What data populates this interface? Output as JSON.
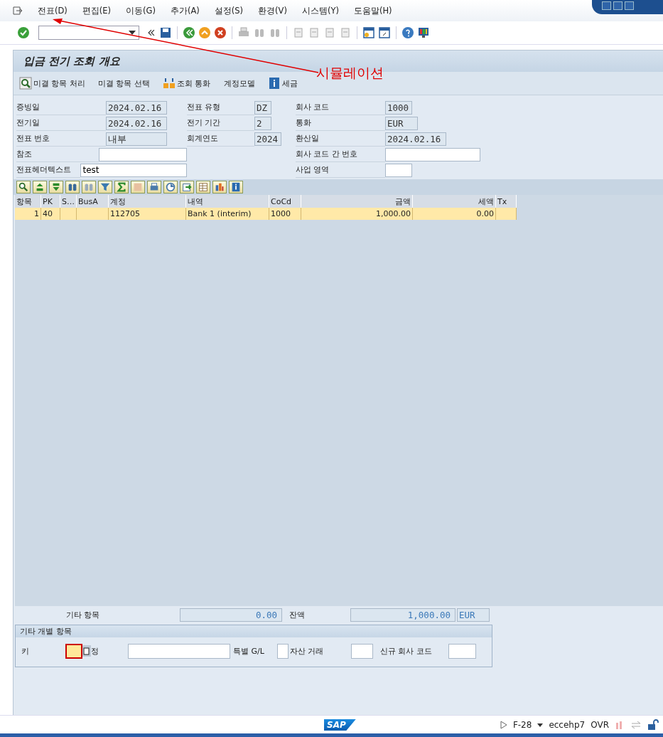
{
  "menu": [
    "전표(D)",
    "편집(E)",
    "이동(G)",
    "추가(A)",
    "설정(S)",
    "환경(V)",
    "시스템(Y)",
    "도움말(H)"
  ],
  "annotation": {
    "text": "시뮬레이션"
  },
  "screen": {
    "title": "입금 전기 조회 개요"
  },
  "app_toolbar": [
    {
      "kind": "icon-text",
      "label": "미결 항목 처리"
    },
    {
      "kind": "text",
      "label": "미결 항목 선택"
    },
    {
      "kind": "currency",
      "label": "조회 통화"
    },
    {
      "kind": "text",
      "label": "계정모델"
    },
    {
      "kind": "info",
      "label": "세금"
    }
  ],
  "header_form": [
    {
      "left": {
        "label": "증빙일",
        "value": "2024.02.16",
        "editable": false
      },
      "middle": {
        "label": "전표 유형",
        "value": "DZ",
        "editable": false
      },
      "right": {
        "label": "회사 코드",
        "value": "1000",
        "editable": false
      }
    },
    {
      "left": {
        "label": "전기일",
        "value": "2024.02.16",
        "editable": false
      },
      "middle": {
        "label": "전기 기간",
        "value": "2",
        "editable": false
      },
      "right": {
        "label": "통화",
        "value": "EUR",
        "editable": false
      }
    },
    {
      "left": {
        "label": "전표 번호",
        "value": "내부",
        "editable": false
      },
      "middle": {
        "label": "회계연도",
        "value": "2024",
        "editable": false
      },
      "right": {
        "label": "환산일",
        "value": "2024.02.16",
        "editable": false
      }
    },
    {
      "left": {
        "label": "참조",
        "editable": true
      },
      "right": {
        "label": "회사 코드 간 번호",
        "editable": true
      }
    },
    {
      "left": {
        "label": "전표헤더텍스트",
        "value": "test",
        "editable": true
      },
      "right": {
        "label": "사업 영역",
        "editable": true
      }
    }
  ],
  "table": {
    "columns": [
      "항목",
      "PK",
      "S…",
      "BusA",
      "계정",
      "내역",
      "CoCd",
      "금액",
      "세액",
      "Tx"
    ],
    "rows": [
      {
        "cells": [
          "1",
          "40",
          "",
          "",
          "112705",
          "Bank 1 (interim)",
          "1000",
          "1,000.00",
          "0.00",
          ""
        ],
        "selected": true
      }
    ]
  },
  "totals": {
    "other_items_label": "기타 항목",
    "other_items_value": "0.00",
    "balance_label": "잔액",
    "balance_value": "1,000.00",
    "currency": "EUR"
  },
  "other_item_group": {
    "title": "기타 개별 항목",
    "key_label": "키",
    "account_label": "정",
    "special_gl_label": "특별 G/L",
    "asset_label": "자산 거래",
    "company_label": "신규 회사 코드"
  },
  "status_bar": {
    "logo": "SAP",
    "transaction": "F-28",
    "system": "eccehp7",
    "mode": "OVR"
  }
}
